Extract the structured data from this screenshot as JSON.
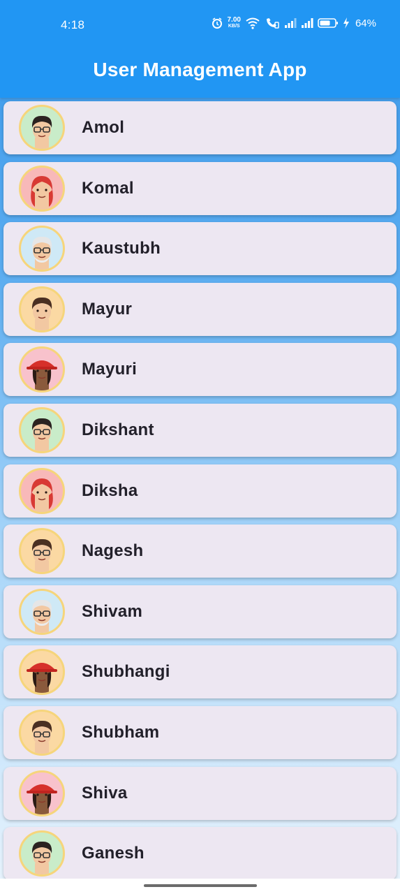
{
  "status_bar": {
    "time": "4:18",
    "net_speed_value": "7.00",
    "net_speed_unit": "KB/S",
    "battery": "64%"
  },
  "app_bar": {
    "title": "User Management App"
  },
  "colors": {
    "app_bar": "#2196f3",
    "card": "#ede7f2",
    "avatar_ring": "#f6d57b"
  },
  "users": [
    {
      "name": "Amol",
      "avatar": "memoji-glasses-dark-hair-icon",
      "bg": "#c9ecc9"
    },
    {
      "name": "Komal",
      "avatar": "memoji-red-hair-wink-icon",
      "bg": "#f8b9b9"
    },
    {
      "name": "Kaustubh",
      "avatar": "memoji-white-hair-glasses-icon",
      "bg": "#cfe9f6"
    },
    {
      "name": "Mayur",
      "avatar": "memoji-brown-hair-icon",
      "bg": "#fbd9a3"
    },
    {
      "name": "Mayuri",
      "avatar": "memoji-red-hat-icon",
      "bg": "#f8c2cc"
    },
    {
      "name": "Dikshant",
      "avatar": "memoji-glasses-dark-hair-icon",
      "bg": "#c9ecc9"
    },
    {
      "name": "Diksha",
      "avatar": "memoji-red-hair-wink-icon",
      "bg": "#f8b9b9"
    },
    {
      "name": "Nagesh",
      "avatar": "memoji-brown-hair-glasses-icon",
      "bg": "#fbd9a3"
    },
    {
      "name": "Shivam",
      "avatar": "memoji-white-hair-glasses-icon",
      "bg": "#cfe9f6"
    },
    {
      "name": "Shubhangi",
      "avatar": "memoji-red-hat-icon",
      "bg": "#fbd9a3"
    },
    {
      "name": "Shubham",
      "avatar": "memoji-brown-hair-glasses-icon",
      "bg": "#fbd9a3"
    },
    {
      "name": "Shiva",
      "avatar": "memoji-red-hat-icon",
      "bg": "#f8c2cc"
    },
    {
      "name": "Ganesh",
      "avatar": "memoji-glasses-dark-hair-icon",
      "bg": "#c9ecc9"
    }
  ]
}
